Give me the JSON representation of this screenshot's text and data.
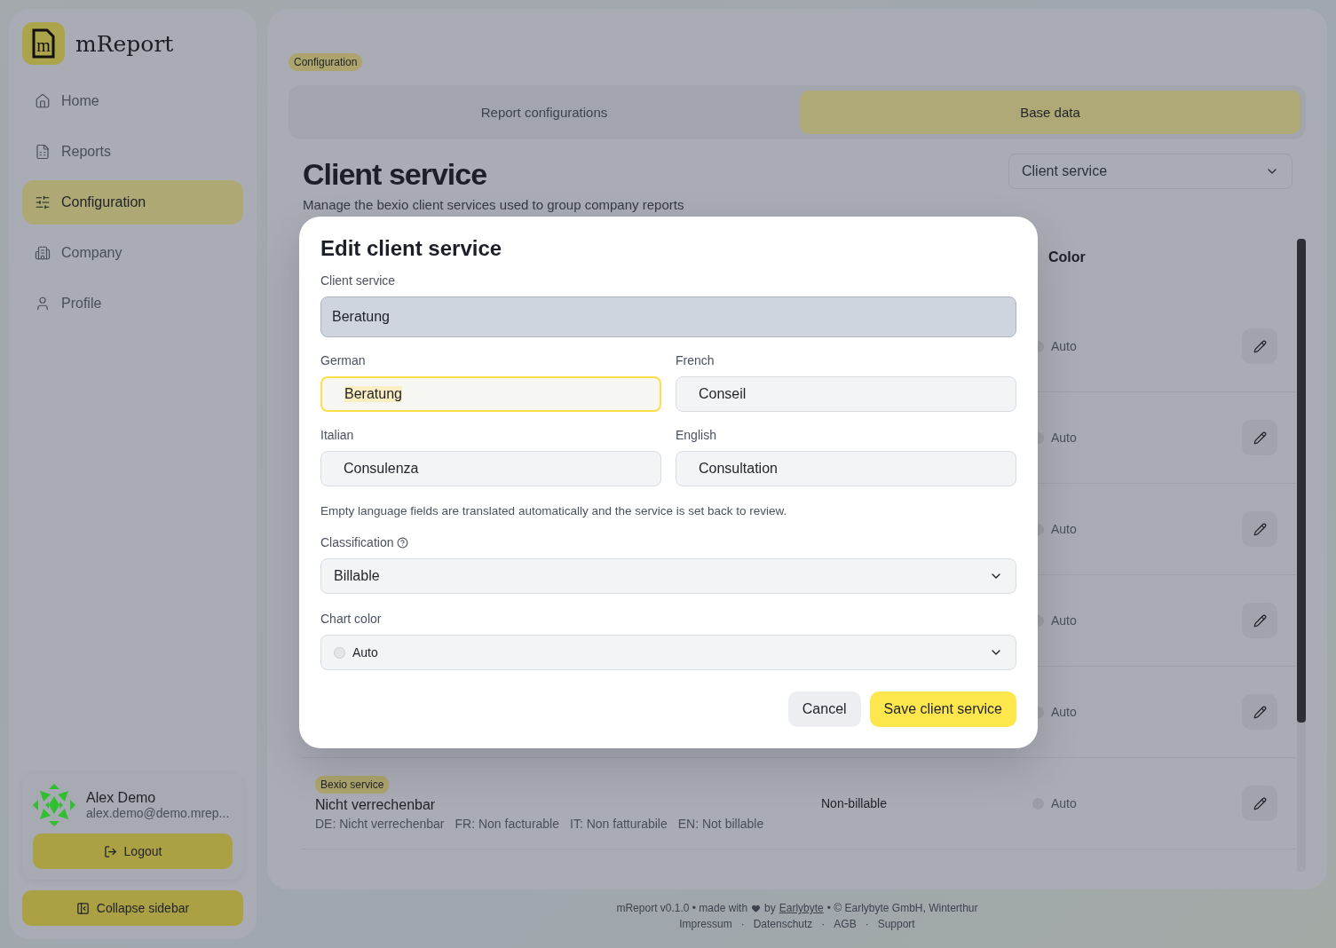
{
  "sidebar": {
    "logo_letter": "m",
    "app_name": "mReport",
    "items": [
      {
        "label": "Home",
        "selected": false
      },
      {
        "label": "Reports",
        "selected": false
      },
      {
        "label": "Configuration",
        "selected": true
      },
      {
        "label": "Company",
        "selected": false
      },
      {
        "label": "Profile",
        "selected": false
      }
    ],
    "user": {
      "name": "Alex Demo",
      "email": "alex.demo@demo.mrep..."
    },
    "logout": "Logout",
    "collapse": "Collapse sidebar"
  },
  "main": {
    "breadcrumb": "Configuration",
    "tabs": [
      {
        "label": "Report configurations",
        "selected": false
      },
      {
        "label": "Base data",
        "selected": true
      }
    ],
    "title": "Client service",
    "subtitle": "Manage the bexio client services used to group company reports",
    "type_select": "Client service",
    "table": {
      "color_header": "Color",
      "rows": [
        {
          "color_label": "Auto"
        },
        {
          "color_label": "Auto"
        },
        {
          "color_label": "Auto"
        },
        {
          "color_label": "Auto"
        },
        {
          "color_label": "Auto"
        },
        {
          "badge": "Bexio service",
          "name": "Nicht verrechenbar",
          "translations": [
            "DE: Nicht verrechenbar",
            "FR: Non facturable",
            "IT: Non fatturabile",
            "EN: Not billable"
          ],
          "classification": "Non-billable",
          "color_label": "Auto"
        }
      ]
    }
  },
  "dialog": {
    "title": "Edit client service",
    "service": {
      "label": "Client service",
      "value": "Beratung",
      "readonly": true
    },
    "languages": [
      {
        "label": "German",
        "value": "Beratung",
        "focused": true
      },
      {
        "label": "French",
        "value": "Conseil",
        "focused": false
      },
      {
        "label": "Italian",
        "value": "Consulenza",
        "focused": false
      },
      {
        "label": "English",
        "value": "Consultation",
        "focused": false
      }
    ],
    "note": "Empty language fields are translated automatically and the service is set back to review.",
    "classification": {
      "label": "Classification",
      "value": "Billable"
    },
    "chart_color": {
      "label": "Chart color",
      "value": "Auto"
    },
    "cancel": "Cancel",
    "save": "Save client service"
  },
  "footer": {
    "version": "mReport v0.1.0 • made with",
    "by": "by",
    "link": "Earlybyte",
    "copyright": "• © Earlybyte GmbH, Winterthur",
    "separator": "·",
    "links": [
      "Impressum",
      "Datenschutz",
      "AGB",
      "Support"
    ]
  }
}
